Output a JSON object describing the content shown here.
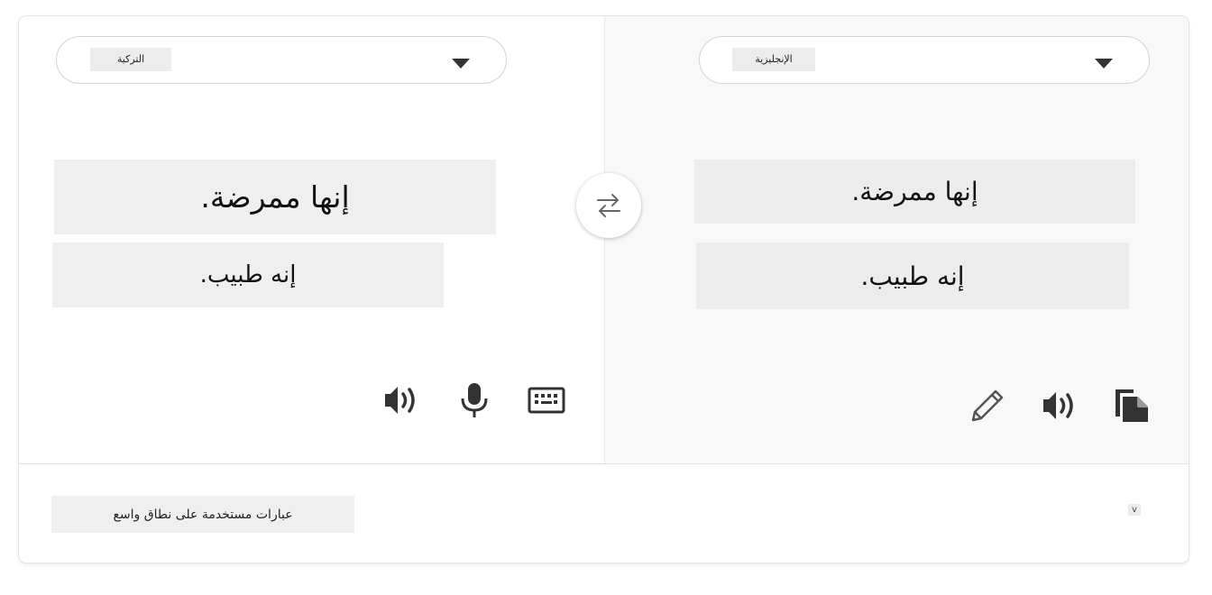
{
  "source": {
    "language_label": "التركية",
    "lines": [
      "إنها ممرضة.",
      "إنه طبيب."
    ],
    "icons": [
      "speaker-icon",
      "microphone-icon",
      "keyboard-icon"
    ]
  },
  "target": {
    "language_label": "الإنجليزية",
    "lines": [
      "إنها ممرضة.",
      "إنه طبيب."
    ],
    "icons": [
      "pencil-icon",
      "speaker-icon",
      "copy-icon"
    ]
  },
  "swap_icon": "swap-arrows-icon",
  "caret_icon": "chevron-down-icon",
  "footer": {
    "phrases_label": "عبارات مستخدمة على نطاق واسع",
    "expand_label": "v"
  },
  "colors": {
    "card_border": "#e4e4e4",
    "target_background": "#f8f8f8",
    "highlight_block": "#efefef",
    "icon": "#333333"
  }
}
